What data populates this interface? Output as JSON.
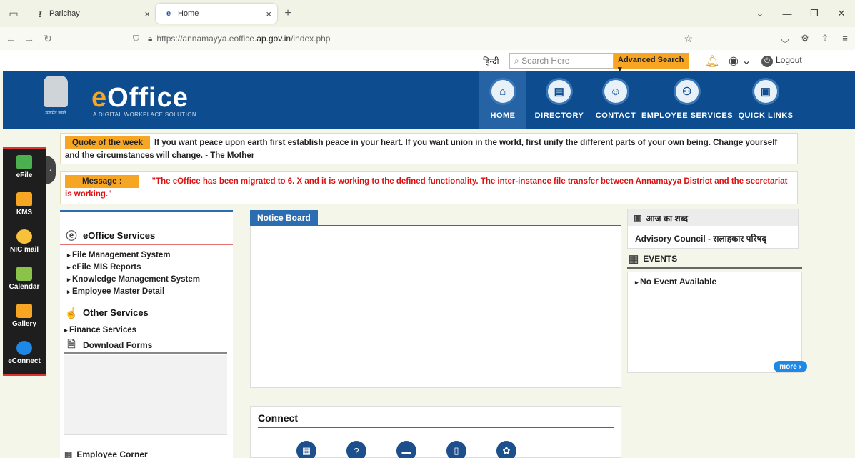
{
  "browser": {
    "tabs": [
      {
        "label": "Parichay"
      },
      {
        "label": "Home"
      }
    ],
    "url_prefix": "https://annamayya.eoffice.",
    "url_bold": "ap.gov.in",
    "url_suffix": "/index.php",
    "new_tab": "+"
  },
  "topbar": {
    "lang": "हिन्दी",
    "search_placeholder": "Search Here",
    "advanced_search": "Advanced Search",
    "logout": "Logout"
  },
  "banner": {
    "logo_e": "e",
    "logo_rest": "Office",
    "tagline": "A DIGITAL WORKPLACE SOLUTION",
    "emblem_caption": "सत्यमेव जयते",
    "nav": [
      {
        "label": "HOME",
        "icon": "home-icon"
      },
      {
        "label": "DIRECTORY",
        "icon": "directory-icon"
      },
      {
        "label": "CONTACT",
        "icon": "contact-icon"
      },
      {
        "label": "EMPLOYEE SERVICES",
        "icon": "employee-services-icon"
      },
      {
        "label": "QUICK LINKS",
        "icon": "quick-links-icon"
      }
    ]
  },
  "sidebar": {
    "items": [
      {
        "label": "eFile",
        "color": "#4caf50"
      },
      {
        "label": "KMS",
        "color": "#f6a623"
      },
      {
        "label": "NIC mail",
        "color": "#f6c23e"
      },
      {
        "label": "Calendar",
        "color": "#8bc34a"
      },
      {
        "label": "Gallery",
        "color": "#f6a623"
      },
      {
        "label": "eConnect",
        "color": "#1e88e5"
      }
    ]
  },
  "quote": {
    "tag": "Quote of the week",
    "text": "If you want peace upon earth first establish peace in your heart. If you want union in the world, first unify the different parts of your own being. Change yourself and the circumstances will change. - The Mother"
  },
  "message": {
    "tag": "Message :",
    "text": "\"The eOffice has been migrated to 6. X and it is working to the defined functionality. The inter-instance file transfer between Annamayya District and the secretariat is working.\""
  },
  "left": {
    "eoffice_title": "eOffice Services",
    "eoffice_items": [
      "File Management System",
      "eFile MIS Reports",
      "Knowledge Management System",
      "Employee Master Detail"
    ],
    "other_title": "Other Services",
    "finance": "Finance Services",
    "download": "Download Forms",
    "employee_corner": "Employee Corner"
  },
  "notice": {
    "title": "Notice Board"
  },
  "connect": {
    "title": "Connect"
  },
  "right": {
    "shabd_title": "आज का शब्द",
    "shabd_word": "Advisory Council - सलाहकार परिषद्",
    "events_title": "EVENTS",
    "no_event": "No Event Available",
    "more": "more ›"
  }
}
